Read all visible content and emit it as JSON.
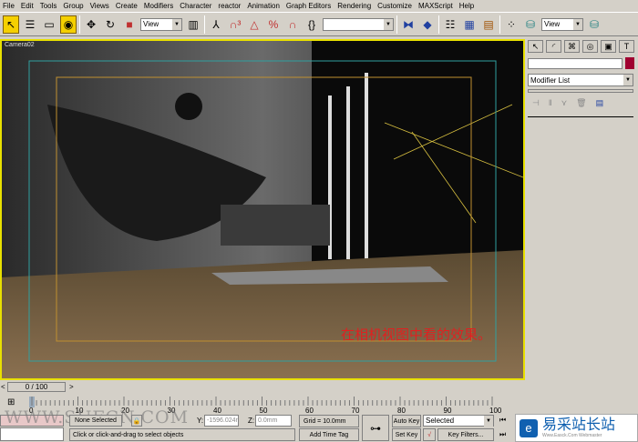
{
  "menu": [
    "File",
    "Edit",
    "Tools",
    "Group",
    "Views",
    "Create",
    "Modifiers",
    "Character",
    "reactor",
    "Animation",
    "Graph Editors",
    "Rendering",
    "Customize",
    "MAXScript",
    "Help"
  ],
  "toolbar": {
    "view_select": "View",
    "view_select2": "View",
    "selection_set": ""
  },
  "viewport": {
    "label": "Camera02",
    "note": "在相机视图中看的效果。",
    "border_color": "#e8e000"
  },
  "panel": {
    "modifier_list": "Modifier List",
    "object_color": "#a00030"
  },
  "time": {
    "slider": "0 / 100",
    "ticks": [
      "0",
      "10",
      "20",
      "30",
      "40",
      "50",
      "60",
      "70",
      "80",
      "90",
      "100"
    ]
  },
  "status": {
    "selection": "None Selected",
    "y_label": "Y:",
    "y_value": "-1596.024r",
    "z_label": "Z:",
    "z_value": "0.0mm",
    "grid": "Grid = 10.0mm",
    "prompt": "Click or click-and-drag to select objects",
    "add_time_tag": "Add Time Tag",
    "auto_key": "Auto Key",
    "set_key": "Set Key",
    "key_mode": "Selected",
    "key_filters": "Key Filters..."
  },
  "watermark": {
    "left": "WWW.SUFCN.COM",
    "logo": "易采站长站",
    "logo_sub": "Www.Easck.Com Webmaster"
  }
}
